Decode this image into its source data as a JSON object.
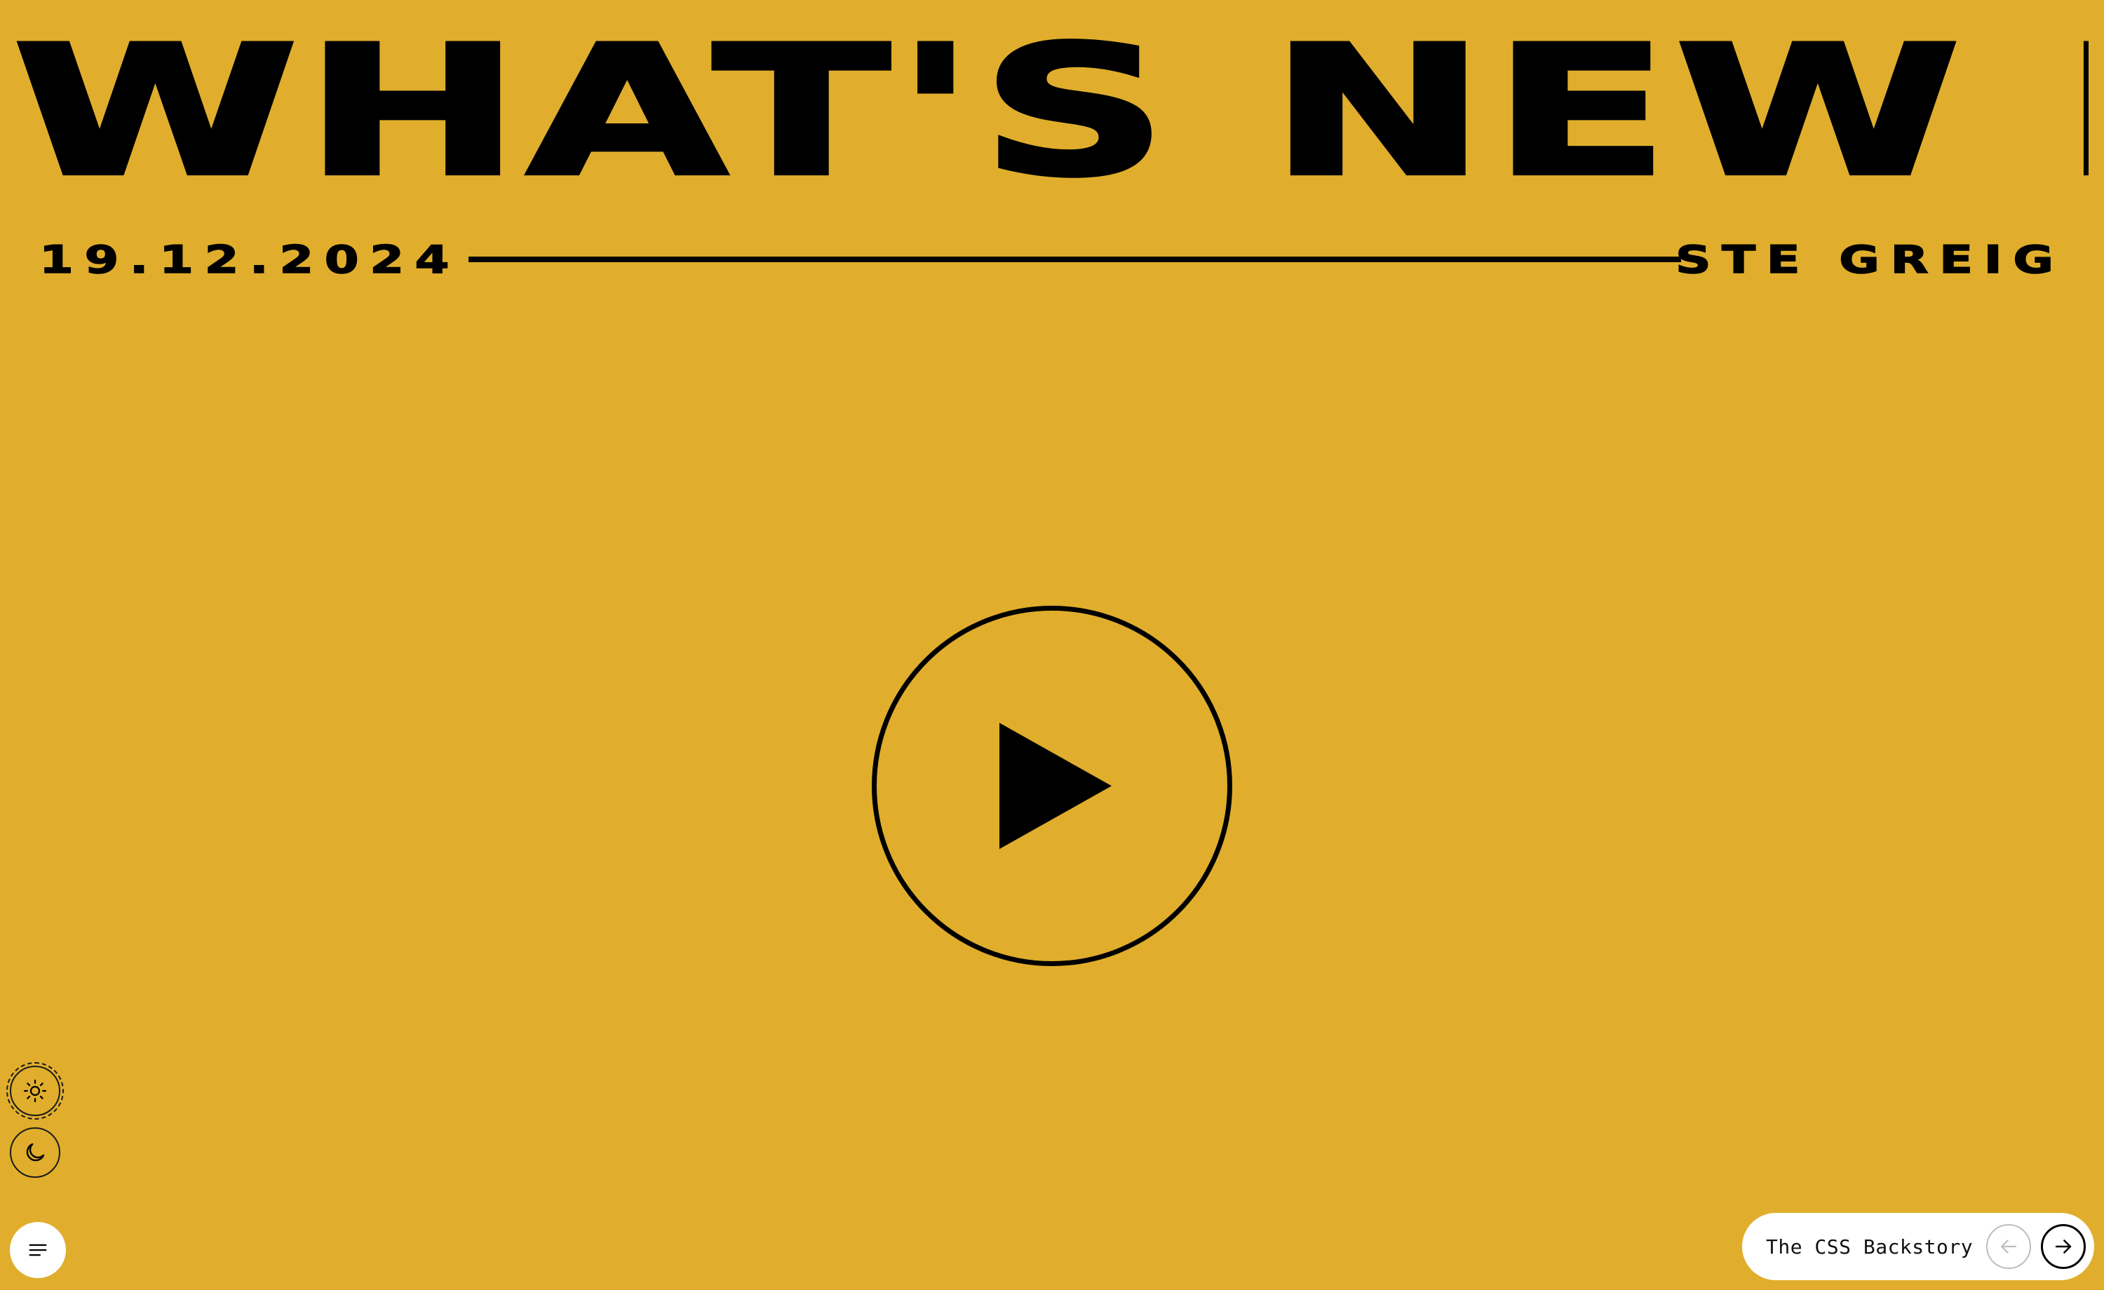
{
  "slide": {
    "title": "WHAT'S NEW IN CSS?",
    "date": "19.12.2024",
    "author": "STE GREIG"
  },
  "controls": {
    "play_icon": "play-icon",
    "light_theme_icon": "sun-icon",
    "dark_theme_icon": "moon-icon",
    "menu_icon": "menu-icon"
  },
  "navigation": {
    "next_title": "The CSS Backstory",
    "prev_icon": "arrow-left-icon",
    "next_icon": "arrow-right-icon"
  },
  "colors": {
    "background": "#e0ae2c",
    "foreground": "#000000",
    "pill": "#ffffff"
  }
}
